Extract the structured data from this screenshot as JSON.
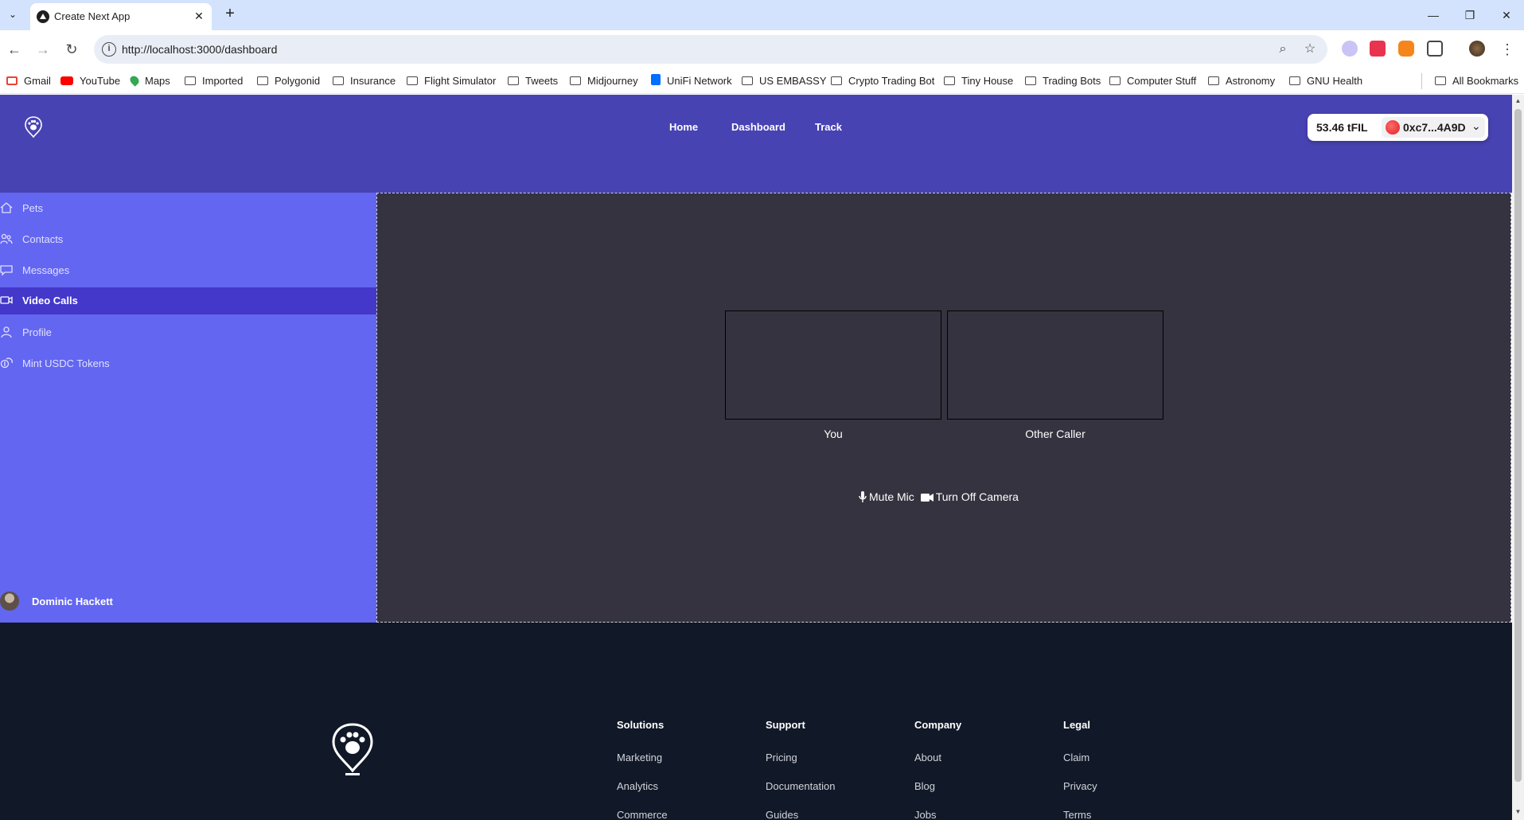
{
  "browser": {
    "tab_title": "Create Next App",
    "url": "http://localhost:3000/dashboard",
    "bookmarks": [
      "Gmail",
      "YouTube",
      "Maps",
      "Imported",
      "Polygonid",
      "Insurance",
      "Flight Simulator",
      "Tweets",
      "Midjourney",
      "UniFi Network",
      "US EMBASSY",
      "Crypto Trading Bot",
      "Tiny House",
      "Trading Bots",
      "Computer Stuff",
      "Astronomy",
      "GNU Health"
    ],
    "all_bookmarks": "All Bookmarks"
  },
  "header": {
    "nav": [
      "Home",
      "Dashboard",
      "Track"
    ],
    "wallet_balance": "53.46 tFIL",
    "wallet_address": "0xc7...4A9D"
  },
  "sidebar": {
    "items": [
      {
        "label": "Pets",
        "icon": "home-icon"
      },
      {
        "label": "Contacts",
        "icon": "users-icon"
      },
      {
        "label": "Messages",
        "icon": "chat-icon"
      },
      {
        "label": "Video Calls",
        "icon": "video-icon"
      },
      {
        "label": "Profile",
        "icon": "user-icon"
      },
      {
        "label": "Mint USDC Tokens",
        "icon": "coins-icon"
      }
    ],
    "active": "Video Calls",
    "user_name": "Dominic Hackett"
  },
  "video": {
    "you_label": "You",
    "other_label": "Other Caller",
    "mute_label": "Mute Mic",
    "camera_label": "Turn Off Camera"
  },
  "footer": {
    "columns": [
      {
        "heading": "Solutions",
        "links": [
          "Marketing",
          "Analytics",
          "Commerce"
        ]
      },
      {
        "heading": "Support",
        "links": [
          "Pricing",
          "Documentation",
          "Guides"
        ]
      },
      {
        "heading": "Company",
        "links": [
          "About",
          "Blog",
          "Jobs"
        ]
      },
      {
        "heading": "Legal",
        "links": [
          "Claim",
          "Privacy",
          "Terms"
        ]
      }
    ]
  },
  "colors": {
    "header_bg": "#4843b3",
    "sidebar_bg": "#6366f1",
    "sidebar_active": "#4338ca",
    "panel_bg": "#34333f",
    "footer_bg": "#111827"
  }
}
